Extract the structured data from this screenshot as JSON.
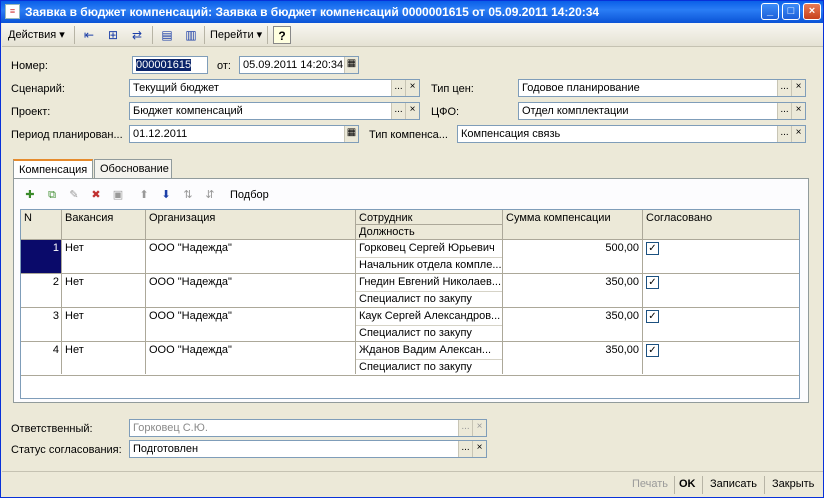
{
  "window": {
    "title": "Заявка в бюджет компенсаций: Заявка в бюджет компенсаций 0000001615 от 05.09.2011 14:20:34",
    "controls": [
      "_",
      "□",
      "×"
    ]
  },
  "toolbar": {
    "actions_label": "Действия ▾",
    "goto_label": "Перейти ▾",
    "help_label": "?"
  },
  "form": {
    "number_label": "Номер:",
    "number_value": "000001615",
    "date_label": "от:",
    "date_value": "05.09.2011 14:20:34",
    "scenario_label": "Сценарий:",
    "scenario_value": "Текущий бюджет",
    "price_type_label": "Тип цен:",
    "price_type_value": "Годовое планирование",
    "project_label": "Проект:",
    "project_value": "Бюджет компенсаций",
    "cfo_label": "ЦФО:",
    "cfo_value": "Отдел комплектации",
    "period_label": "Период планирован...",
    "period_value": "01.12.2011",
    "comp_type_label": "Тип компенса...",
    "comp_type_value": "Компенсация связь",
    "ellipsis": "...",
    "clear": "×",
    "calendar": "▦"
  },
  "tabs": [
    {
      "label": "Компенсация"
    },
    {
      "label": "Обоснование"
    }
  ],
  "panel_toolbar": {
    "pick_label": "Подбор"
  },
  "table": {
    "headers": {
      "n": "N",
      "vacancy": "Вакансия",
      "org": "Организация",
      "employee": "Сотрудник",
      "position": "Должность",
      "amount": "Сумма компенсации",
      "approved": "Согласовано"
    },
    "rows": [
      {
        "n": "1",
        "vacancy": "Нет",
        "org": "ООО \"Надежда\"",
        "employee": "Горковец Сергей Юрьевич",
        "position": "Начальник отдела компле...",
        "amount": "500,00",
        "approved": "✓"
      },
      {
        "n": "2",
        "vacancy": "Нет",
        "org": "ООО \"Надежда\"",
        "employee": "Гнедин Евгений Николаев...",
        "position": "Специалист по закупу",
        "amount": "350,00",
        "approved": "✓"
      },
      {
        "n": "3",
        "vacancy": "Нет",
        "org": "ООО \"Надежда\"",
        "employee": "Каук Сергей Александров...",
        "position": "Специалист по закупу",
        "amount": "350,00",
        "approved": "✓"
      },
      {
        "n": "4",
        "vacancy": "Нет",
        "org": "ООО \"Надежда\"",
        "employee": "Жданов Вадим Алексан...",
        "position": "Специалист по закупу",
        "amount": "350,00",
        "approved": "✓"
      }
    ]
  },
  "footer": {
    "responsible_label": "Ответственный:",
    "responsible_value": "Горковец С.Ю.",
    "status_label": "Статус согласования:",
    "status_value": "Подготовлен"
  },
  "statusbar": {
    "print_label": "Печать",
    "ok_label": "OK",
    "save_label": "Записать",
    "close_label": "Закрыть"
  }
}
